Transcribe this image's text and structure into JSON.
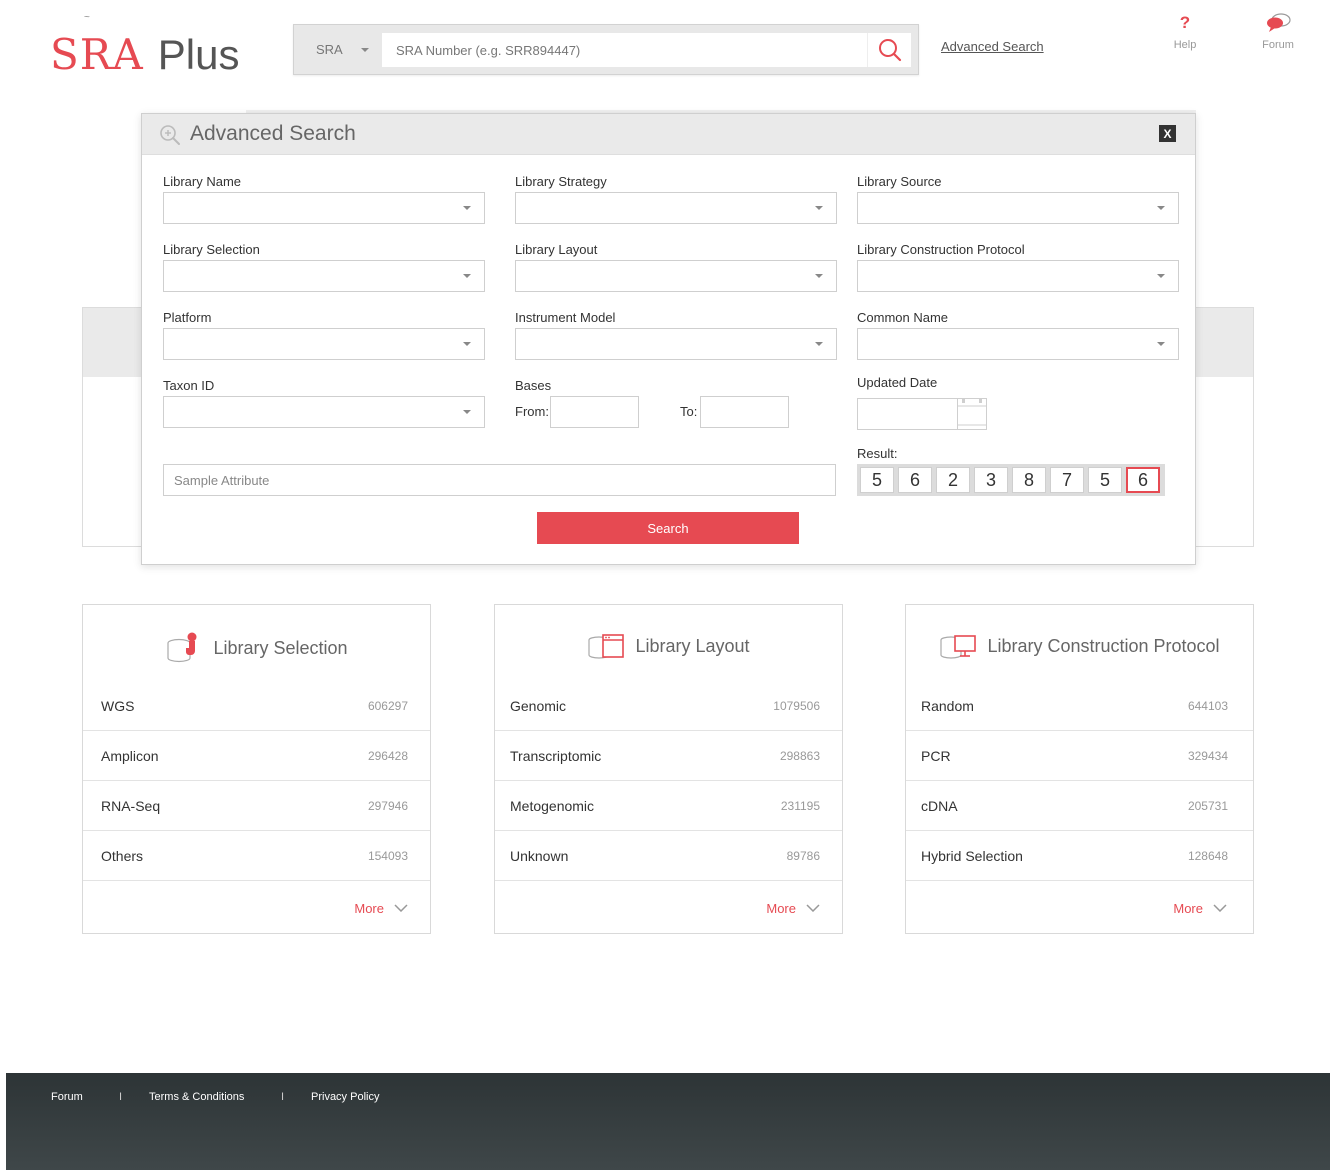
{
  "header": {
    "logo_primary": "SRA",
    "logo_secondary": "Plus",
    "logo_mark": "~",
    "search": {
      "db_selected": "SRA",
      "placeholder": "SRA Number (e.g. SRR894447)",
      "value": ""
    },
    "advanced_search_link": "Advanced Search",
    "help_label": "Help",
    "help_glyph": "?",
    "forum_label": "Forum"
  },
  "modal": {
    "title": "Advanced Search",
    "close_label": "X",
    "fields": {
      "library_name": "Library Name",
      "library_strategy": "Library Strategy",
      "library_source": "Library Source",
      "library_selection": "Library Selection",
      "library_layout": "Library Layout",
      "library_construction_protocol": "Library Construction Protocol",
      "platform": "Platform",
      "instrument_model": "Instrument Model",
      "common_name": "Common Name",
      "taxon_id": "Taxon ID",
      "bases": "Bases",
      "bases_from": "From:",
      "bases_to": "To:",
      "updated_date": "Updated Date",
      "sample_attribute_placeholder": "Sample Attribute",
      "result_label": "Result:"
    },
    "result_digits": [
      "5",
      "6",
      "2",
      "3",
      "8",
      "7",
      "5",
      "6"
    ],
    "search_button": "Search"
  },
  "cards": [
    {
      "title": "Library Selection",
      "items": [
        {
          "name": "WGS",
          "count": "606297"
        },
        {
          "name": "Amplicon",
          "count": "296428"
        },
        {
          "name": "RNA-Seq",
          "count": "297946"
        },
        {
          "name": "Others",
          "count": "154093"
        }
      ],
      "more": "More"
    },
    {
      "title": "Library Layout",
      "items": [
        {
          "name": "Genomic",
          "count": "1079506"
        },
        {
          "name": "Transcriptomic",
          "count": "298863"
        },
        {
          "name": "Metogenomic",
          "count": "231195"
        },
        {
          "name": "Unknown",
          "count": "89786"
        }
      ],
      "more": "More"
    },
    {
      "title": "Library Construction Protocol",
      "items": [
        {
          "name": "Random",
          "count": "644103"
        },
        {
          "name": "PCR",
          "count": "329434"
        },
        {
          "name": "cDNA",
          "count": "205731"
        },
        {
          "name": "Hybrid Selection",
          "count": "128648"
        }
      ],
      "more": "More"
    }
  ],
  "footer": {
    "links": [
      "Forum",
      "Terms & Conditions",
      "Privacy Policy"
    ],
    "separator": "I"
  },
  "colors": {
    "accent": "#e64a52",
    "footer_bg": "#2d3436",
    "panel_gray": "#eaeaea"
  }
}
